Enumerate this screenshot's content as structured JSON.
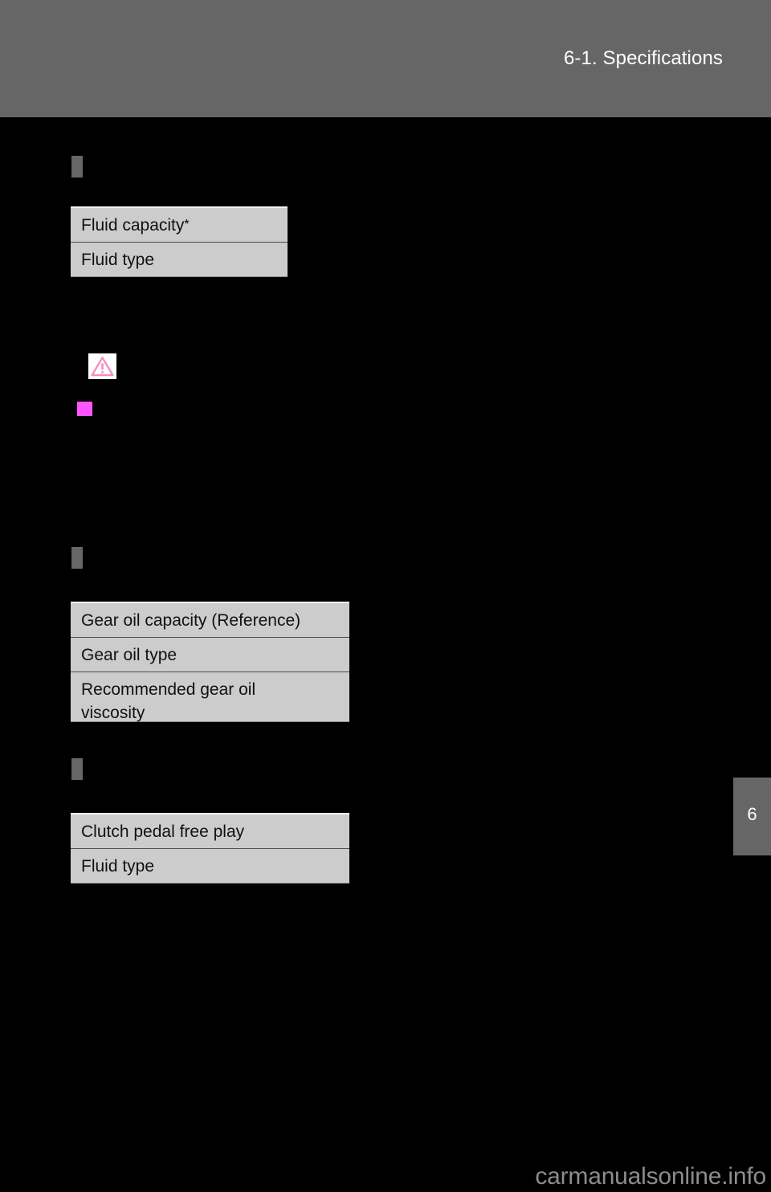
{
  "header": {
    "title": "6-1. Specifications",
    "band_color": "#666666",
    "text_color": "#ffffff"
  },
  "sections": [
    {
      "marker": "section-marker",
      "table": {
        "rows": [
          {
            "label": "Fluid capacity",
            "superscript": "*"
          },
          {
            "label": "Fluid type",
            "superscript": ""
          }
        ]
      }
    },
    {
      "marker": "section-marker",
      "table": {
        "rows": [
          {
            "label": "Gear oil capacity (Reference)",
            "superscript": ""
          },
          {
            "label": "Gear oil type",
            "superscript": ""
          },
          {
            "label": "Recommended gear oil\nviscosity",
            "superscript": ""
          }
        ]
      }
    },
    {
      "marker": "section-marker",
      "table": {
        "rows": [
          {
            "label": "Clutch pedal free play",
            "superscript": ""
          },
          {
            "label": "Fluid type",
            "superscript": ""
          }
        ]
      }
    }
  ],
  "notices": {
    "warning_icon": "warning-triangle-icon",
    "warning_icon_color": "#f48fc0",
    "warning_icon_bg": "#ffffff",
    "bullet_square_color": "#ff55ff"
  },
  "chapter_tab": {
    "number": "6",
    "color": "#666666"
  },
  "footer": {
    "watermark": "carmanualsonline.info",
    "watermark_color": "#8c8c8c"
  },
  "page": {
    "background": "#000000",
    "table_cell_color": "#cccccc"
  }
}
